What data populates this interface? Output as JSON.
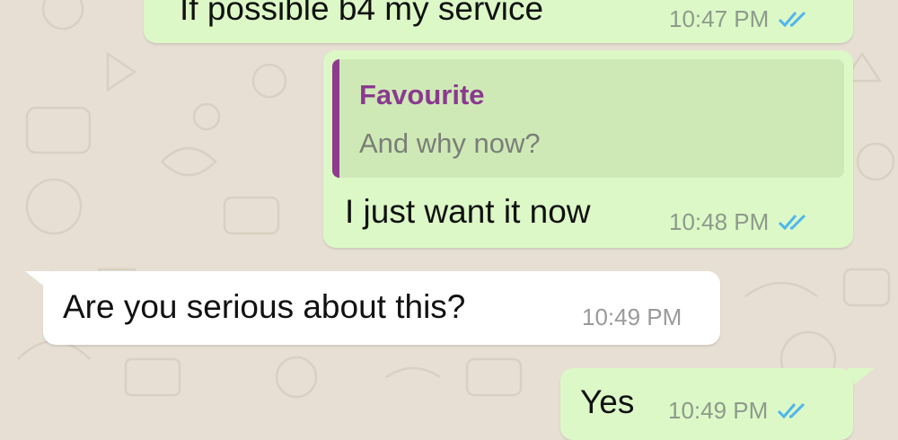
{
  "colors": {
    "wallpaper": "#e7dfd4",
    "outgoing_bubble": "#dcf8c6",
    "incoming_bubble": "#ffffff",
    "quote_bar": "#8e3b8e",
    "read_ticks": "#4fb6ec"
  },
  "messages": [
    {
      "direction": "outgoing",
      "text": "If possible b4 my service",
      "time": "10:47 PM",
      "status_icon": "double-check-read-icon"
    },
    {
      "direction": "outgoing",
      "quote": {
        "author": "Favourite",
        "text": "And why now?"
      },
      "text": "I just want it now",
      "time": "10:48 PM",
      "status_icon": "double-check-read-icon"
    },
    {
      "direction": "incoming",
      "text": "Are you serious about this?",
      "time": "10:49 PM"
    },
    {
      "direction": "outgoing",
      "text": "Yes",
      "time": "10:49 PM",
      "status_icon": "double-check-read-icon"
    }
  ]
}
